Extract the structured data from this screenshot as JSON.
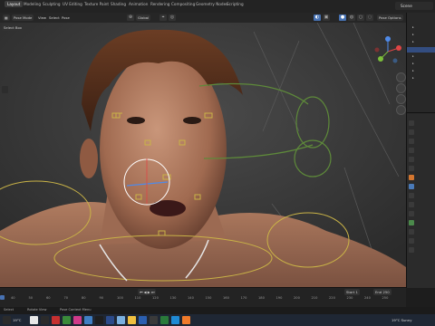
{
  "workspace_tabs": [
    "Layout",
    "Modeling",
    "Sculpting",
    "UV Editing",
    "Texture Paint",
    "Shading",
    "Animation",
    "Rendering",
    "Compositing",
    "Geometry Nodes",
    "Scripting"
  ],
  "scene": {
    "label": "Scene"
  },
  "header": {
    "mode": "Pose Mode",
    "view": "View",
    "select": "Select",
    "pose": "Pose",
    "orientation": "Global",
    "options": "Pose Options"
  },
  "row3": {
    "select_box": "Select Box"
  },
  "timeline": {
    "ticks": [
      "40",
      "50",
      "60",
      "70",
      "80",
      "90",
      "100",
      "110",
      "120",
      "130",
      "140",
      "150",
      "160",
      "170",
      "180",
      "190",
      "200",
      "210",
      "220",
      "230",
      "240",
      "250"
    ],
    "start_label": "Start",
    "start_value": "1",
    "end_label": "End",
    "end_value": "250"
  },
  "statusbar": {
    "select": "Select",
    "rotate_view": "Rotate View",
    "pose_menu": "Pose Context Menu"
  },
  "taskbar": {
    "weather": "19°C  Sunny",
    "temp_short": "19°C"
  },
  "colors": {
    "accent": "#4772b3",
    "rig_yellow": "#c9b347",
    "rig_green": "#5e8a3a",
    "skin": "#b8866a"
  }
}
